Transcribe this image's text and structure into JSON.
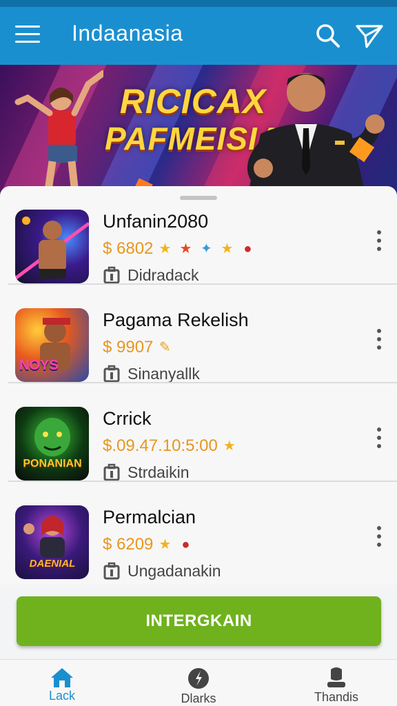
{
  "app_bar": {
    "title": "Indaanasia",
    "icons": {
      "menu": "hamburger-icon",
      "search": "search-icon",
      "filter": "filter-icon"
    }
  },
  "banner": {
    "line1": "RICICAX",
    "line2": "PAFMEISIA"
  },
  "items": [
    {
      "name": "Unfanin2080",
      "price": "$ 6802",
      "badges": [
        "★",
        "★",
        "✦",
        "★",
        "●"
      ],
      "meta": "Didradack"
    },
    {
      "name": "Pagama Rekelish",
      "price": "$ 9907",
      "badges": [
        "✎"
      ],
      "meta": "Sinanyallk"
    },
    {
      "name": "Crrick",
      "price": "$.09.47.10:5:00",
      "badges": [
        "★"
      ],
      "meta": "Strdaikin"
    },
    {
      "name": "Permalcian",
      "price": "$ 6209",
      "badges": [
        "★",
        "●"
      ],
      "meta": "Ungadanakin"
    }
  ],
  "thumb_labels": [
    "",
    "NOYS",
    "PONANIAN",
    "DAENIAL"
  ],
  "cta": {
    "label": "INTERGKAIN"
  },
  "bottom_nav": [
    {
      "label": "Lack",
      "icon": "home-icon",
      "active": true
    },
    {
      "label": "Dlarks",
      "icon": "compass-icon",
      "active": false
    },
    {
      "label": "Thandis",
      "icon": "profile-icon",
      "active": false
    }
  ],
  "colors": {
    "app_bar": "#1a8fcf",
    "price": "#e8961e",
    "cta": "#6fb21d",
    "nav_active": "#1a8fcf"
  }
}
